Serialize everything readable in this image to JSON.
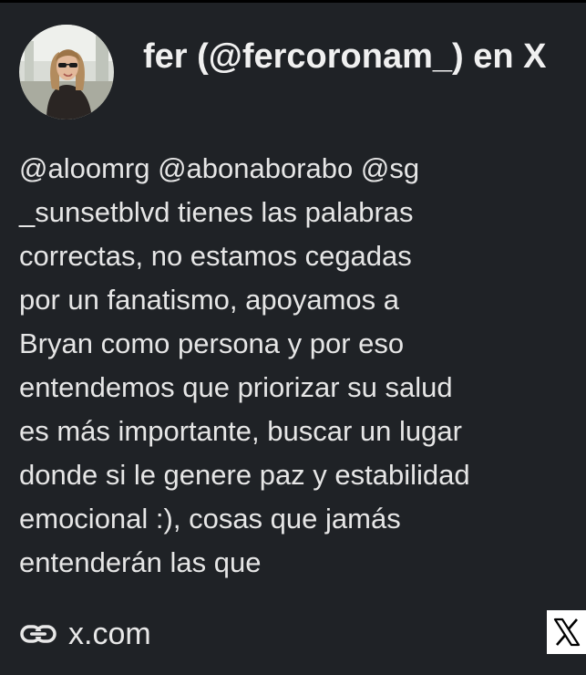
{
  "author": {
    "title": "fer (@fercoronam_) en X",
    "avatar_icon": "profile-photo"
  },
  "post": {
    "lines": [
      "@aloomrg @abonaborabo @sg",
      "_sunsetblvd tienes las palabras",
      "correctas, no estamos cegadas",
      "por un fanatismo, apoyamos a",
      "Bryan como persona y por eso",
      "entendemos que priorizar su salud",
      "es más importante, buscar un lugar",
      "donde si le genere paz y estabilidad",
      "emocional :), cosas que jamás",
      "entenderán las que"
    ]
  },
  "footer": {
    "link_icon": "link-icon",
    "domain": "x.com",
    "brand_icon": "x-logo-icon"
  },
  "colors": {
    "background": "#1f2226",
    "text": "#e6e6e6"
  }
}
